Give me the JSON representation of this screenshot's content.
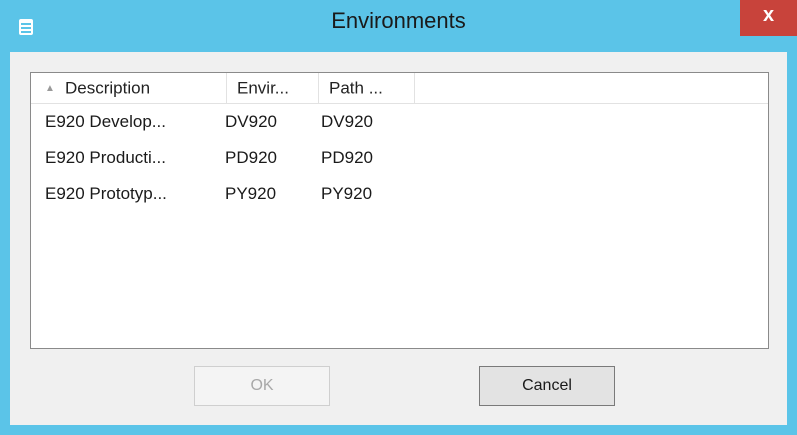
{
  "window": {
    "title": "Environments",
    "close_glyph": "x"
  },
  "colors": {
    "titlebar": "#5bc4e8",
    "close_button": "#c8433b",
    "client_bg": "#f0f0f0"
  },
  "icons": {
    "app": "app-icon",
    "sort": "sort-ascending-icon",
    "close": "close-icon"
  },
  "list": {
    "sort_glyph": "▲",
    "columns": [
      "Description",
      "Envir...",
      "Path ..."
    ],
    "rows": [
      [
        "E920 Develop...",
        "DV920",
        "DV920"
      ],
      [
        "E920 Producti...",
        "PD920",
        "PD920"
      ],
      [
        "E920 Prototyp...",
        "PY920",
        "PY920"
      ]
    ]
  },
  "buttons": {
    "ok_label": "OK",
    "cancel_label": "Cancel"
  }
}
